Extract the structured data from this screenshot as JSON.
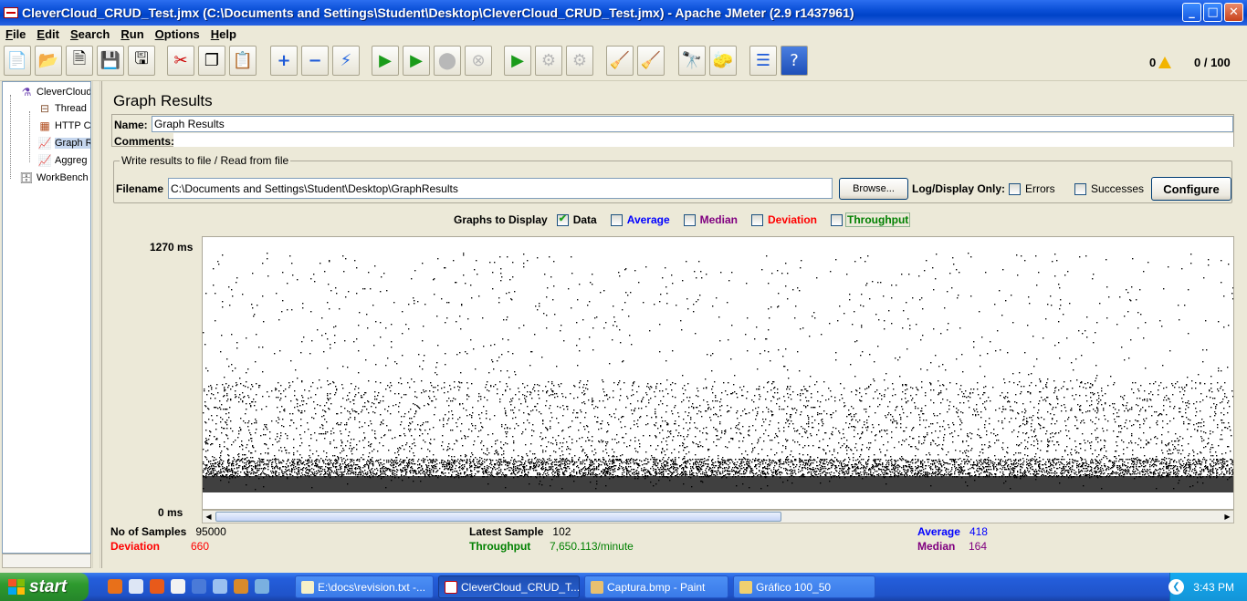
{
  "window": {
    "title": "CleverCloud_CRUD_Test.jmx (C:\\Documents and Settings\\Student\\Desktop\\CleverCloud_CRUD_Test.jmx) - Apache JMeter (2.9 r1437961)",
    "minimize": "_",
    "maximize": "□",
    "close": "✕"
  },
  "menu": [
    "File",
    "Edit",
    "Search",
    "Run",
    "Options",
    "Help"
  ],
  "toolbar": {
    "error_count": "0",
    "threads": "0 / 100",
    "icons": [
      "new-icon",
      "open-icon",
      "close-icon",
      "save-icon",
      "save-as-icon",
      "cut-icon",
      "copy-icon",
      "paste-icon",
      "expand-icon",
      "collapse-icon",
      "toggle-icon",
      "start-icon",
      "start-no-pause-icon",
      "stop-icon",
      "shutdown-icon",
      "remote-start-icon",
      "remote-stop-icon",
      "remote-exit-icon",
      "clear-icon",
      "clear-all-icon",
      "search-icon",
      "reset-search-icon",
      "function-helper-icon",
      "help-icon"
    ]
  },
  "tree": {
    "items": [
      {
        "label": "CleverCloud",
        "icon": "flask-icon"
      },
      {
        "label": "Thread",
        "icon": "spool-icon"
      },
      {
        "label": "HTTP C",
        "icon": "http-config-icon"
      },
      {
        "label": "Graph R",
        "icon": "graph-icon"
      },
      {
        "label": "Aggreg",
        "icon": "graph-icon"
      },
      {
        "label": "WorkBench",
        "icon": "workbench-icon"
      }
    ]
  },
  "panel": {
    "title": "Graph Results",
    "name_label": "Name:",
    "name_value": "Graph Results",
    "comments_label": "Comments:",
    "comments_value": "",
    "file_group_title": "Write results to file / Read from file",
    "filename_label": "Filename",
    "filename_value": "C:\\Documents and Settings\\Student\\Desktop\\GraphResults",
    "browse_label": "Browse...",
    "log_display_label": "Log/Display Only:",
    "errors_label": "Errors",
    "successes_label": "Successes",
    "configure_label": "Configure",
    "graphs_to_display_label": "Graphs to Display",
    "graph_options": [
      {
        "label": "Data",
        "checked": true,
        "color": "#000000"
      },
      {
        "label": "Average",
        "checked": false,
        "color": "#0000ff"
      },
      {
        "label": "Median",
        "checked": false,
        "color": "#800080"
      },
      {
        "label": "Deviation",
        "checked": false,
        "color": "#ff0000"
      },
      {
        "label": "Throughput",
        "checked": false,
        "color": "#008000"
      }
    ]
  },
  "chart_data": {
    "type": "scatter",
    "title": "",
    "xlabel": "",
    "ylabel": "",
    "y_max_label": "1270 ms",
    "y_min_label": "0 ms",
    "ylim": [
      0,
      1270
    ],
    "series": [
      {
        "name": "Data",
        "color": "#000000",
        "points": 95000,
        "median": 164,
        "average": 418,
        "deviation": 660
      }
    ]
  },
  "stats": {
    "samples_label": "No of Samples",
    "samples_value": "95000",
    "deviation_label": "Deviation",
    "deviation_value": "660",
    "latest_label": "Latest Sample",
    "latest_value": "102",
    "throughput_label": "Throughput",
    "throughput_value": "7,650.113/minute",
    "average_label": "Average",
    "average_value": "418",
    "median_label": "Median",
    "median_value": "164",
    "colors": {
      "deviation": "#ff0000",
      "throughput": "#008000",
      "average": "#0000ff",
      "median": "#800080"
    }
  },
  "taskbar": {
    "start_label": "start",
    "tasks": [
      {
        "label": "E:\\docs\\revision.txt -...",
        "active": false
      },
      {
        "label": "CleverCloud_CRUD_T...",
        "active": true
      },
      {
        "label": "Captura.bmp - Paint",
        "active": false
      },
      {
        "label": "Gráfico 100_50",
        "active": false
      }
    ],
    "clock": "3:43 PM"
  }
}
